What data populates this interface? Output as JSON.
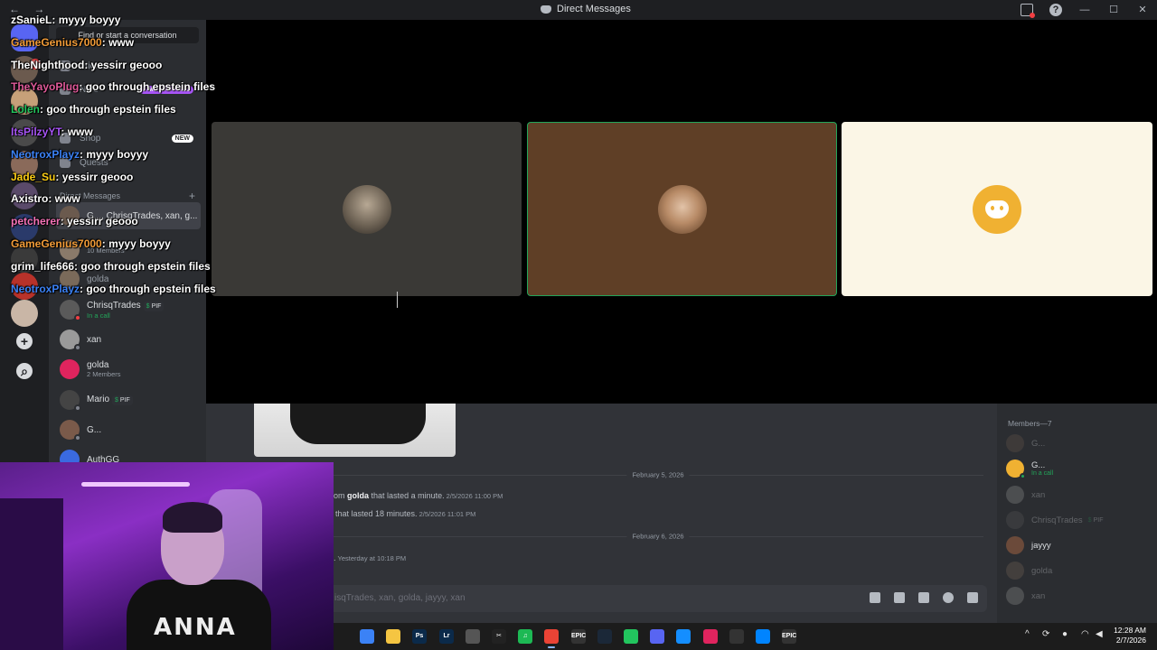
{
  "window": {
    "title": "Direct Messages",
    "nav_back": "←",
    "nav_forward": "→",
    "minimize": "—",
    "maximize": "☐",
    "close": "✕"
  },
  "sidebar": {
    "find_placeholder": "Find or start a conversation",
    "nav": [
      {
        "label": "Friends"
      },
      {
        "label": "Nitro",
        "badge": "1 MONTH FREE",
        "badge_color": "#a855f7"
      },
      {
        "label": "Shop",
        "badge": "NEW",
        "badge_color": "#ffffff"
      },
      {
        "label": "Quests"
      }
    ],
    "dm_header": "Direct Messages",
    "dm_add": "+",
    "dms": [
      {
        "name": "G..., ChrisqTrades, xan, g...",
        "sub": "",
        "selected": true,
        "color": "#6b5a4e"
      },
      {
        "name": "",
        "sub": "10 Members",
        "color": "#8a7a6a"
      },
      {
        "name": "golda",
        "sub": "",
        "color": "#7a6a5a"
      },
      {
        "name": "ChrisqTrades",
        "pif": "PIF",
        "sub": "In a call",
        "call": true,
        "color": "#5a5a5a"
      },
      {
        "name": "xan",
        "sub": "",
        "color": "#9a9a9a"
      },
      {
        "name": "golda",
        "sub": "2 Members",
        "color": "#e0245e"
      },
      {
        "name": "Mario",
        "pif": "PIF",
        "sub": "",
        "color": "#444"
      },
      {
        "name": "G...",
        "sub": "",
        "color": "#7a5a4a"
      },
      {
        "name": "AuthGG",
        "sub": "",
        "color": "#3a6ae0"
      }
    ]
  },
  "rail": {
    "badge_count": "3",
    "add_server": "+",
    "discover": "⌕"
  },
  "call_tiles": [
    {
      "name": "participant-1"
    },
    {
      "name": "participant-2",
      "speaking": true
    },
    {
      "name": "participant-3"
    }
  ],
  "chat": {
    "date_1": "February 5, 2026",
    "msg_1_prefix": "om",
    "msg_1_name": "golda",
    "msg_1_text": "that lasted a minute.",
    "msg_1_time": "2/5/2026 11:00 PM",
    "msg_2_text": "that lasted 18 minutes.",
    "msg_2_time": "2/5/2026 11:01 PM",
    "date_2": "February 6, 2026",
    "msg_3_text": ".",
    "msg_3_time": "Yesterday at 10:18 PM",
    "input_placeholder": "isqTrades, xan, golda, jayyy, xan"
  },
  "members": {
    "title": "Members—7",
    "list": [
      {
        "name": "G...",
        "sub": "",
        "offline": true,
        "color": "#6b5a4e"
      },
      {
        "name": "G...",
        "sub": "In a call",
        "offline": false,
        "color": "#f0b132"
      },
      {
        "name": "xan",
        "sub": "",
        "offline": true,
        "color": "#9a9a9a"
      },
      {
        "name": "ChrisqTrades",
        "pif": "PIF",
        "sub": "",
        "offline": true,
        "color": "#5a5a5a"
      },
      {
        "name": "jayyy",
        "sub": "",
        "offline": false,
        "color": "#6b4a3a"
      },
      {
        "name": "golda",
        "sub": "",
        "offline": true,
        "color": "#7a6a5a"
      },
      {
        "name": "xan",
        "sub": "",
        "offline": true,
        "color": "#9a9a9a"
      }
    ]
  },
  "stream_chat": [
    {
      "user": "zSanieL",
      "color": "#ffffff",
      "text": ": myyy boyyy"
    },
    {
      "user": "GameGenius7000",
      "color": "#f29c38",
      "text": ": www"
    },
    {
      "user": "TheNighthood",
      "color": "#ffffff",
      "text": ": yessirr geooo"
    },
    {
      "user": "TheYayoPlug",
      "color": "#e05a9a",
      "text": ": goo through epstein files"
    },
    {
      "user": "Lolen",
      "color": "#22c55e",
      "text": ": goo through epstein files"
    },
    {
      "user": "ItsPilzyYT",
      "color": "#a855f7",
      "text": ": www"
    },
    {
      "user": "NeotroxPlayz",
      "color": "#3b82f6",
      "text": ": myyy boyyy"
    },
    {
      "user": "Jade_Su",
      "color": "#facc15",
      "text": ": yessirr geooo"
    },
    {
      "user": "Axistro",
      "color": "#ffffff",
      "text": ": www"
    },
    {
      "user": "petcherer",
      "color": "#f472b6",
      "text": ": yessirr geooo"
    },
    {
      "user": "GameGenius7000",
      "color": "#f29c38",
      "text": ": myyy boyyy"
    },
    {
      "user": "grim_life666",
      "color": "#ffffff",
      "text": ": goo through epstein files"
    },
    {
      "user": "NeotroxPlayz",
      "color": "#3b82f6",
      "text": ": goo through epstein files"
    }
  ],
  "webcam": {
    "shirt_text": "ANNA"
  },
  "taskbar": {
    "apps": [
      {
        "name": "windows-start",
        "label": "",
        "color": "#3b82f6"
      },
      {
        "name": "file-explorer",
        "label": "",
        "color": "#f5c542"
      },
      {
        "name": "photoshop",
        "label": "Ps",
        "color": "#0b2a4a"
      },
      {
        "name": "lightroom",
        "label": "Lr",
        "color": "#0b2a4a"
      },
      {
        "name": "microsoft-store",
        "label": "",
        "color": "#555555"
      },
      {
        "name": "capcut",
        "label": "✂",
        "color": "#222222"
      },
      {
        "name": "spotify",
        "label": "♫",
        "color": "#1db954"
      },
      {
        "name": "chrome",
        "label": "",
        "color": "#ea4335",
        "active": true
      },
      {
        "name": "epic-games",
        "label": "EPIC",
        "color": "#333333"
      },
      {
        "name": "steam",
        "label": "",
        "color": "#1b2838"
      },
      {
        "name": "robinhood",
        "label": "",
        "color": "#22c55e"
      },
      {
        "name": "discord",
        "label": "",
        "color": "#5865f2"
      },
      {
        "name": "battle-net",
        "label": "",
        "color": "#148eff"
      },
      {
        "name": "hd-app",
        "label": "",
        "color": "#e0245e"
      },
      {
        "name": "obs",
        "label": "",
        "color": "#333333"
      },
      {
        "name": "messenger",
        "label": "",
        "color": "#0084ff"
      },
      {
        "name": "epic-games-2",
        "label": "EPIC",
        "color": "#333333"
      }
    ],
    "tray_chevron": "^",
    "time": "12:28 AM",
    "date": "2/7/2026"
  }
}
